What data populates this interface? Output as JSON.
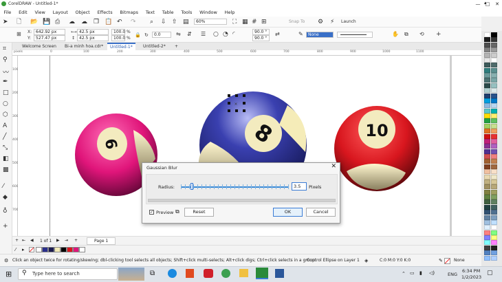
{
  "window": {
    "title": "CorelDRAW - Untitled-1*",
    "minimize": "—",
    "maximize": "□",
    "close": "✕"
  },
  "menu": [
    "File",
    "Edit",
    "View",
    "Layout",
    "Object",
    "Effects",
    "Bitmaps",
    "Text",
    "Table",
    "Tools",
    "Window",
    "Help"
  ],
  "toolbar": {
    "zoom_value": "60%",
    "snap_label": "Snap To",
    "launch_label": "Launch"
  },
  "props": {
    "x_label": "X:",
    "x_value": "642.92 px",
    "y_label": "Y:",
    "y_value": "527.47 px",
    "w_value": "42.5 px",
    "h_value": "42.5 px",
    "scale_w": "100.0",
    "scale_h": "100.0",
    "pct1": "%",
    "pct2": "%",
    "rotation": "0.0",
    "angle1": "90.0 °",
    "angle2": "90.0 °",
    "fill_value": "None"
  },
  "tabs": [
    {
      "label": "Welcome Screen"
    },
    {
      "label": "Bi-a minh hoa.cdr*"
    },
    {
      "label": "Untitled-1*"
    },
    {
      "label": "Untitled-2*"
    },
    {
      "label": "+"
    }
  ],
  "ruler": {
    "unit": "pixels",
    "h_ticks": [
      "0",
      "100",
      "200",
      "300",
      "400",
      "500",
      "600",
      "700",
      "800",
      "900",
      "1000",
      "1100"
    ],
    "v_ticks": [
      "100",
      "200",
      "300",
      "400",
      "500",
      "600",
      "700"
    ]
  },
  "balls": [
    {
      "number": "6",
      "color": "#e0157a"
    },
    {
      "number": "8",
      "color": "#2a2f8c"
    },
    {
      "number": "10",
      "color": "#d8161e"
    }
  ],
  "dialog": {
    "title": "Gaussian Blur",
    "radius_label": "Radius:",
    "radius_value": "3.5",
    "unit_label": "Pixels",
    "preview_label": "Preview",
    "reset_label": "Reset",
    "ok_label": "OK",
    "cancel_label": "Cancel",
    "preview_checked": true,
    "radius_position": 0.1
  },
  "pagebar": {
    "page_counter": "1 of 1",
    "page_tab": "Page 1"
  },
  "document_palette": [
    "#ffffff",
    "#2a2f8c",
    "#1c1c50",
    "#f1eab8",
    "#000000",
    "#d8161e",
    "#e0157a",
    "#ffffff"
  ],
  "status": {
    "hint": "Click an object twice for rotating/skewing; dbl-clicking tool selects all objects; Shift+click multi-selects; Alt+click digs; Ctrl+click selects in a group",
    "object_info": "Control Ellipse on Layer 1",
    "fill_info": "C:0 M:0 Y:0 K:0",
    "outline_info": "None"
  },
  "taskbar": {
    "search_placeholder": "Type here to search",
    "language": "ENG",
    "time": "6:34 PM",
    "date": "1/2/2023"
  },
  "palette_colors": [
    "#ffffff",
    "#000000",
    "#1a1a1a",
    "#333333",
    "#4d4d4d",
    "#666666",
    "#808080",
    "#999999",
    "#b3b3b3",
    "#cccccc",
    "#e6e6e6",
    "#ffffff",
    "#3d5a5a",
    "#4f6b6b",
    "#2e7d7d",
    "#5a8f8f",
    "#6b9a9a",
    "#88b0b0",
    "#4a7070",
    "#7aa6a6",
    "#2b4a4a",
    "#96c0c0",
    "#b0cfcf",
    "#dce9e9",
    "#1f3f6e",
    "#28528a",
    "#00a0e0",
    "#0078c8",
    "#8ab8e0",
    "#b7d6f0",
    "#5cc8c8",
    "#00b0b0",
    "#ffdd00",
    "#ffef70",
    "#20a040",
    "#60c060",
    "#a0d060",
    "#c8e090",
    "#e07020",
    "#f0a060",
    "#d01010",
    "#e83030",
    "#c0207a",
    "#e060a0",
    "#8a3090",
    "#b060c0",
    "#503090",
    "#7050b0",
    "#d05050",
    "#f08080",
    "#a06030",
    "#c08050",
    "#804020",
    "#a06840",
    "#f0c0a0",
    "#f8e0c8",
    "#e8d8b0",
    "#f0e8c8",
    "#c0b080",
    "#d8c898",
    "#a09060",
    "#b8a878",
    "#808040",
    "#a0a060",
    "#608040",
    "#80a060",
    "#406040",
    "#608060",
    "#204040",
    "#406060",
    "#305070",
    "#507090",
    "#6080a0",
    "#80a0c0",
    "#a0c0e0",
    "#c0e0ff",
    "#e0f0ff",
    "#ffffff",
    "#ff8080",
    "#80ff80",
    "#8080ff",
    "#ffff80",
    "#80ffff",
    "#ff80ff",
    "#404040",
    "#202020",
    "#5080c0",
    "#70a0e0",
    "#90c0ff",
    "#b0d0ff"
  ]
}
